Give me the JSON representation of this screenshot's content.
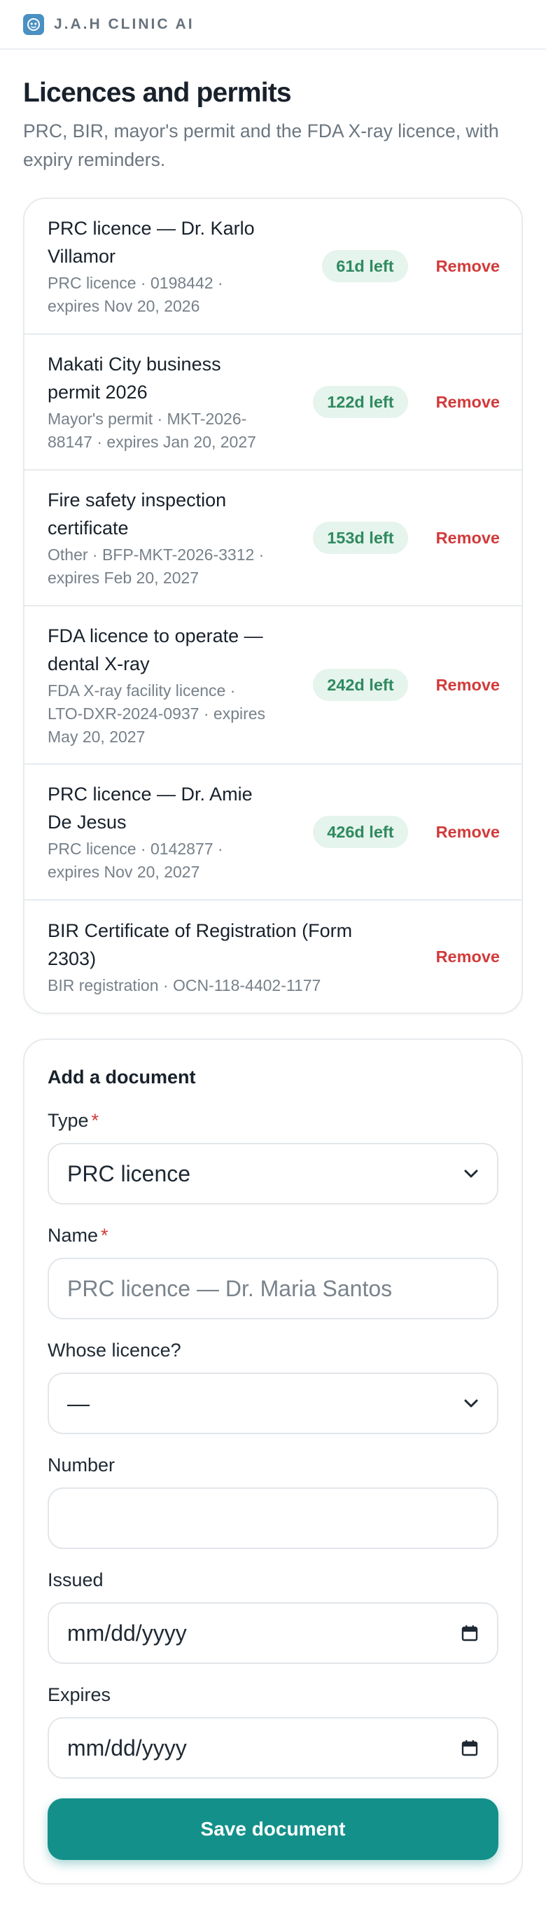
{
  "app": {
    "brand": "J.A.H CLINIC AI"
  },
  "page": {
    "title": "Licences and permits",
    "subtitle": "PRC, BIR, mayor's permit and the FDA X-ray licence, with expiry reminders."
  },
  "documents": [
    {
      "name": "PRC licence — Dr. Karlo Villamor",
      "meta": "PRC licence · 0198442 · expires Nov 20, 2026",
      "days_left": "61d left",
      "remove_label": "Remove"
    },
    {
      "name": "Makati City business permit 2026",
      "meta": "Mayor's permit · MKT-2026-88147 · expires Jan 20, 2027",
      "days_left": "122d left",
      "remove_label": "Remove"
    },
    {
      "name": "Fire safety inspection certificate",
      "meta": "Other · BFP-MKT-2026-3312 · expires Feb 20, 2027",
      "days_left": "153d left",
      "remove_label": "Remove"
    },
    {
      "name": "FDA licence to operate — dental X-ray",
      "meta": "FDA X-ray facility licence · LTO-DXR-2024-0937 · expires May 20, 2027",
      "days_left": "242d left",
      "remove_label": "Remove"
    },
    {
      "name": "PRC licence — Dr. Amie De Jesus",
      "meta": "PRC licence · 0142877 · expires Nov 20, 2027",
      "days_left": "426d left",
      "remove_label": "Remove"
    },
    {
      "name": "BIR Certificate of Registration (Form 2303)",
      "meta": "BIR registration · OCN-118-4402-1177",
      "days_left": "",
      "remove_label": "Remove"
    }
  ],
  "form": {
    "title": "Add a document",
    "required_mark": "*",
    "type_label": "Type",
    "type_value": "PRC licence",
    "name_label": "Name",
    "name_placeholder": "PRC licence — Dr. Maria Santos",
    "whose_label": "Whose licence?",
    "whose_value": "—",
    "number_label": "Number",
    "number_value": "",
    "issued_label": "Issued",
    "issued_placeholder": "mm/dd/yyyy",
    "expires_label": "Expires",
    "expires_placeholder": "mm/dd/yyyy",
    "save_label": "Save document"
  },
  "colors": {
    "accent": "#14908a",
    "danger": "#d23a3a",
    "badge_bg": "#e5f4ec",
    "badge_text": "#2f8a5f"
  }
}
